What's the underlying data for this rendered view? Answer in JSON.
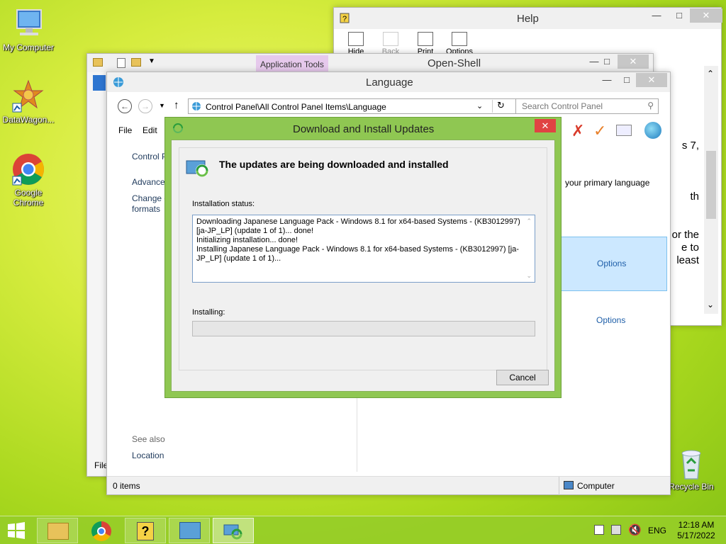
{
  "desktop": {
    "icons": [
      {
        "label": "My Computer"
      },
      {
        "label": "DataWagon..."
      },
      {
        "label": "Google Chrome"
      },
      {
        "label": "Recycle Bin"
      }
    ]
  },
  "help_window": {
    "title": "Help",
    "toolbar": [
      "Hide",
      "Back",
      "Print",
      "Options"
    ],
    "visible_text": [
      "s 7,",
      "th",
      "or the",
      "e to",
      "least"
    ]
  },
  "openshell_window": {
    "title": "Open-Shell",
    "ribbon_tab": "Application Tools",
    "status_fragment": "File"
  },
  "language_window": {
    "title": "Language",
    "address": "Control Panel\\All Control Panel Items\\Language",
    "search_placeholder": "Search Control Panel",
    "menu": [
      "File",
      "Edit"
    ],
    "left_pane": {
      "control_panel": "Control P",
      "advanced": "Advance",
      "change_line1": "Change d",
      "change_line2": "formats",
      "see_also": "See also",
      "location": "Location"
    },
    "right_pane": {
      "primary_language_text": "your primary language",
      "options1": "Options",
      "options2": "Options"
    },
    "status_items": "0 items",
    "status_computer": "Computer"
  },
  "dialog": {
    "title": "Download and Install Updates",
    "heading": "The updates are being downloaded and installed",
    "installation_status_label": "Installation status:",
    "log_lines": [
      "Downloading Japanese Language Pack - Windows 8.1 for x64-based Systems - (KB3012997)",
      "[ja-JP_LP] (update 1 of 1)... done!",
      "Initializing installation... done!",
      "Installing Japanese Language Pack - Windows 8.1 for x64-based Systems - (KB3012997) [ja-",
      "JP_LP] (update 1 of 1)..."
    ],
    "installing_label": "Installing:",
    "progress_fraction": 0,
    "cancel_label": "Cancel"
  },
  "taskbar": {
    "language": "ENG",
    "time": "12:18 AM",
    "date": "5/17/2022"
  },
  "colors": {
    "dialog_frame": "#8fc752",
    "selection": "#cce8ff",
    "link": "#1e5ea8",
    "close_red": "#e04343"
  }
}
